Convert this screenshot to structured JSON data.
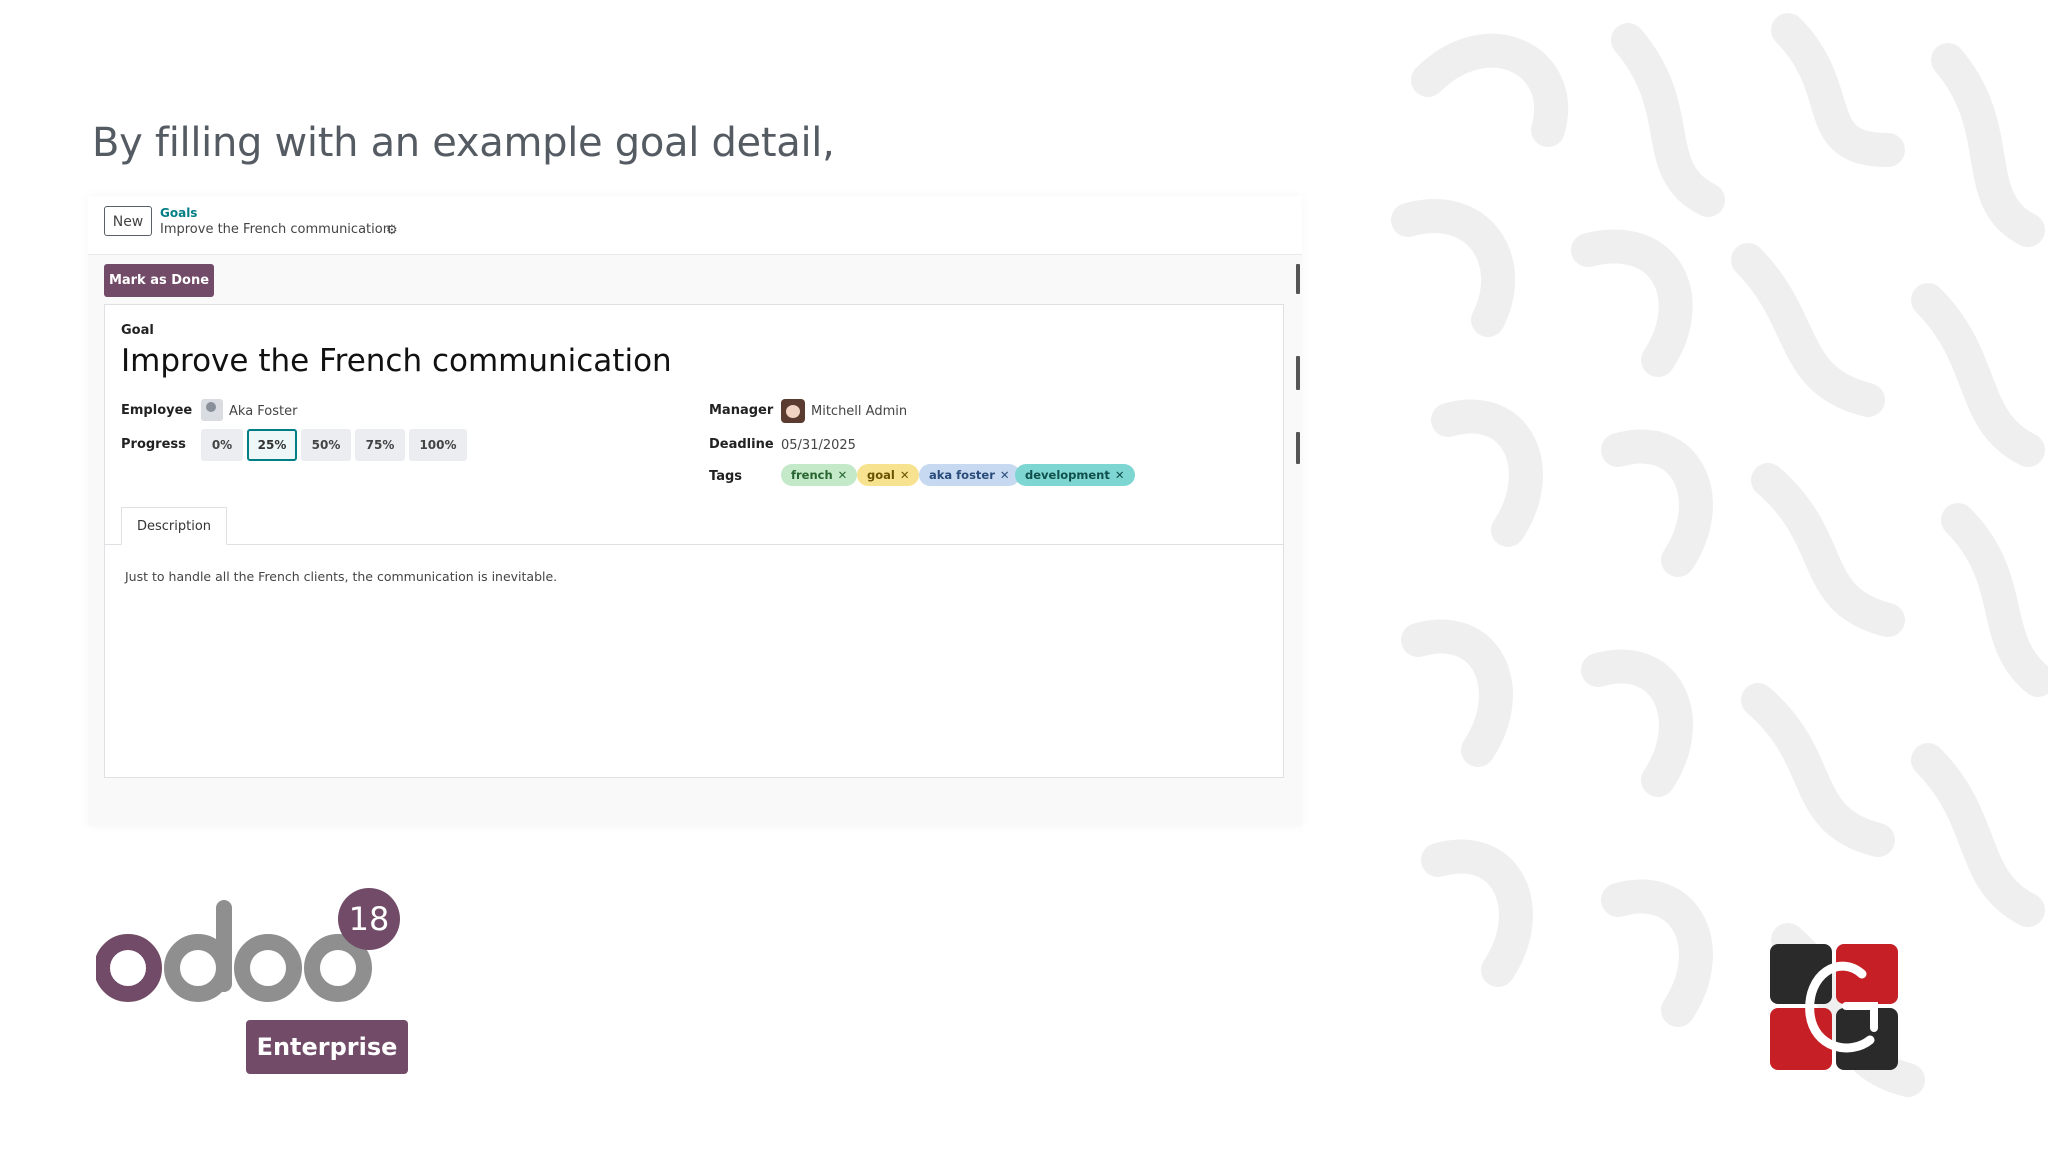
{
  "slide": {
    "title": "By filling with an example goal detail,"
  },
  "control_panel": {
    "new_label": "New",
    "breadcrumb_parent": "Goals",
    "breadcrumb_current": "Improve the French communication",
    "mark_done_label": "Mark as Done"
  },
  "form": {
    "goal_label": "Goal",
    "goal_title": "Improve the French communication",
    "employee_label": "Employee",
    "employee_value": "Aka Foster",
    "progress_label": "Progress",
    "progress_options": [
      "0%",
      "25%",
      "50%",
      "75%",
      "100%"
    ],
    "progress_selected": "25%",
    "manager_label": "Manager",
    "manager_value": "Mitchell Admin",
    "deadline_label": "Deadline",
    "deadline_value": "05/31/2025",
    "tags_label": "Tags",
    "tags": [
      {
        "label": "french",
        "color": "#c3e9c9",
        "text": "#26632f"
      },
      {
        "label": "goal",
        "color": "#f7e38f",
        "text": "#6b5200"
      },
      {
        "label": "aka foster",
        "color": "#c6d9f1",
        "text": "#2a4b7a"
      },
      {
        "label": "development",
        "color": "#7ed6d2",
        "text": "#0f4f4c"
      }
    ],
    "tab_description": "Description",
    "description_text": "Just to handle all the French clients, the communication is inevitable."
  },
  "logos": {
    "version_badge": "18",
    "enterprise_label": "Enterprise",
    "brand_color": "#714b67"
  }
}
